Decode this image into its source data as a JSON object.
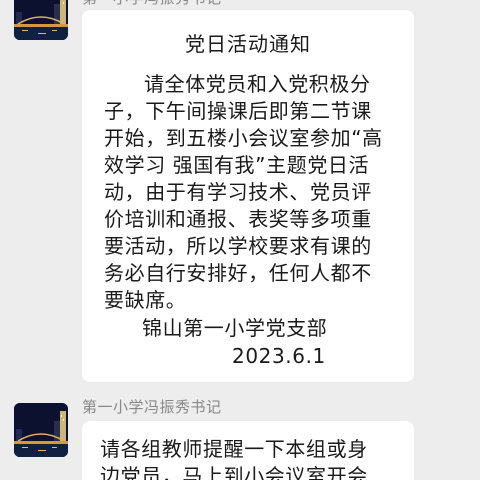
{
  "messages": [
    {
      "sender": "第一小学冯振秀书记",
      "avatar_icon": "city-night-bridge-avatar",
      "title": "党日活动通知",
      "body_lines": [
        "请全体党员和入党积极分",
        "子，下午间操课后即第二节课",
        "开始，到五楼小会议室参加“高",
        "效学习 强国有我”主题党日活",
        "动，由于有学习技术、党员评",
        "价培训和通报、表奖等多项重",
        "要活动，所以学校要求有课的",
        "务必自行安排好，任何人都不",
        "要缺席。"
      ],
      "signature_org": "锦山第一小学党支部",
      "signature_date": "2023.6.1"
    },
    {
      "sender": "第一小学冯振秀书记",
      "avatar_icon": "city-night-bridge-avatar",
      "body_lines": [
        "请各组教师提醒一下本组或身",
        "边党员，马上到小会议室开会"
      ]
    }
  ],
  "colors": {
    "background": "#ededed",
    "bubble": "#ffffff",
    "text": "#1a1a1a",
    "sender": "#888888"
  }
}
